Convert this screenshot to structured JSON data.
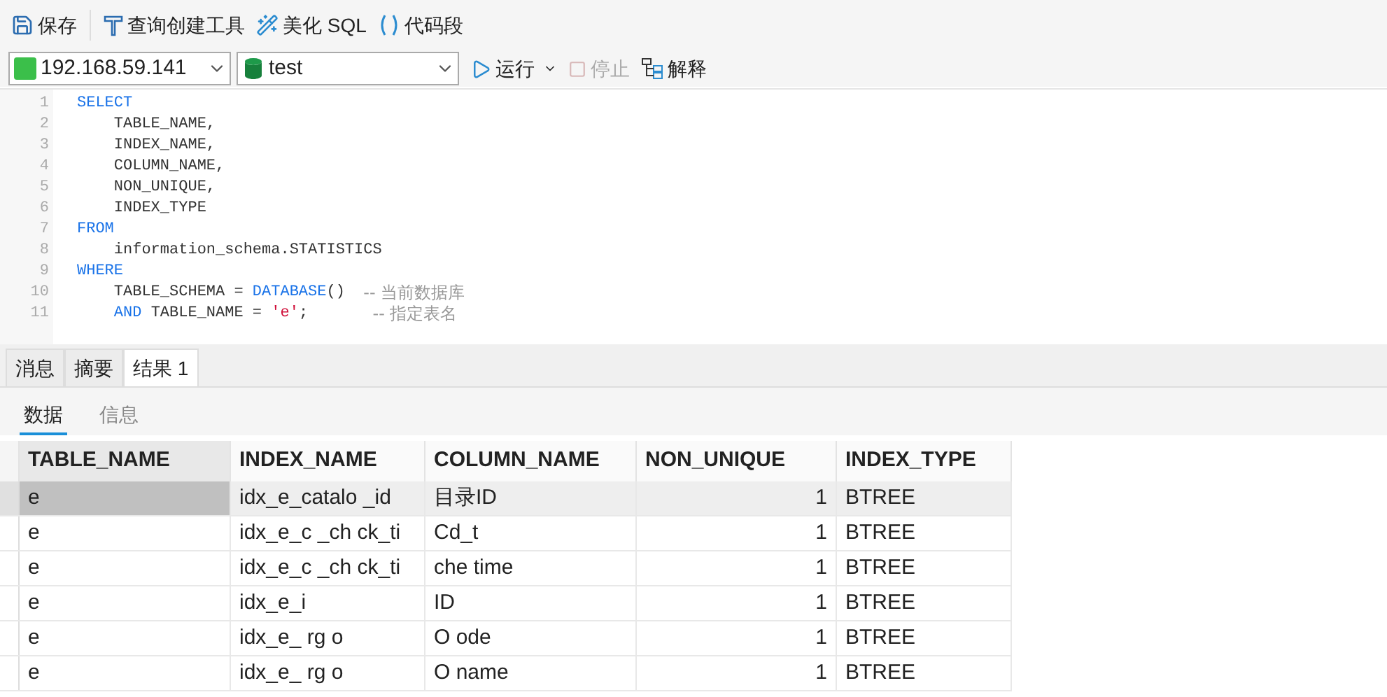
{
  "toolbar": [
    {
      "label": "保存"
    },
    {
      "label": "查询创建工具"
    },
    {
      "label": "美化 SQL"
    },
    {
      "label": "代码段"
    }
  ],
  "connection": {
    "value": "192.168.59.141"
  },
  "database": {
    "value": "test"
  },
  "actions": [
    {
      "label": "运行",
      "kind": "run",
      "disabled": false
    },
    {
      "label": "停止",
      "kind": "stop",
      "disabled": true
    },
    {
      "label": "解释",
      "kind": "explain",
      "disabled": false
    }
  ],
  "editor": {
    "lines": [
      {
        "number": "1",
        "tokens": [
          {
            "text": "SELECT",
            "kind": "keyword"
          }
        ]
      },
      {
        "number": "2",
        "tokens": [
          {
            "text": "    TABLE_NAME,",
            "kind": "plain"
          }
        ]
      },
      {
        "number": "3",
        "tokens": [
          {
            "text": "    INDEX_NAME,",
            "kind": "plain"
          }
        ]
      },
      {
        "number": "4",
        "tokens": [
          {
            "text": "    COLUMN_NAME,",
            "kind": "plain"
          }
        ]
      },
      {
        "number": "5",
        "tokens": [
          {
            "text": "    NON_UNIQUE,",
            "kind": "plain"
          }
        ]
      },
      {
        "number": "6",
        "tokens": [
          {
            "text": "    INDEX_TYPE",
            "kind": "plain"
          }
        ]
      },
      {
        "number": "7",
        "tokens": [
          {
            "text": "FROM",
            "kind": "keyword"
          }
        ]
      },
      {
        "number": "8",
        "tokens": [
          {
            "text": "    information_schema.STATISTICS",
            "kind": "plain"
          }
        ]
      },
      {
        "number": "9",
        "tokens": [
          {
            "text": "WHERE",
            "kind": "keyword"
          }
        ]
      },
      {
        "number": "10",
        "tokens": [
          {
            "text": "    TABLE_SCHEMA = ",
            "kind": "plain"
          },
          {
            "text": "DATABASE",
            "kind": "keyword"
          },
          {
            "text": "()  ",
            "kind": "plain"
          },
          {
            "text": "-- 当前数据库",
            "kind": "comment"
          }
        ]
      },
      {
        "number": "11",
        "tokens": [
          {
            "text": "    AND",
            "kind": "keyword"
          },
          {
            "text": " TABLE_NAME = ",
            "kind": "plain"
          },
          {
            "text": "'e'",
            "kind": "string"
          },
          {
            "text": ";       ",
            "kind": "plain"
          },
          {
            "text": "-- 指定表名",
            "kind": "comment"
          }
        ]
      }
    ]
  },
  "result_tabs": [
    {
      "label": "消息",
      "selected": false
    },
    {
      "label": "摘要",
      "selected": false
    },
    {
      "label": "结果 1",
      "selected": true
    }
  ],
  "sub_tabs": [
    {
      "label": "数据",
      "selected": true
    },
    {
      "label": "信息",
      "selected": false
    }
  ],
  "table": {
    "columns": [
      {
        "label": "TABLE_NAME",
        "kind": "text"
      },
      {
        "label": "INDEX_NAME",
        "kind": "text"
      },
      {
        "label": "COLUMN_NAME",
        "kind": "text"
      },
      {
        "label": "NON_UNIQUE",
        "kind": "number"
      },
      {
        "label": "INDEX_TYPE",
        "kind": "text"
      }
    ],
    "rows": [
      {
        "selected": true,
        "cells": [
          "e",
          "idx_e_catalo _id",
          "目录ID",
          "1",
          "BTREE"
        ]
      },
      {
        "selected": false,
        "cells": [
          "e",
          "idx_e_c _ch ck_ti",
          "Cd_t",
          "1",
          "BTREE"
        ]
      },
      {
        "selected": false,
        "cells": [
          "e",
          "idx_e_c _ch ck_ti",
          "che time",
          "1",
          "BTREE"
        ]
      },
      {
        "selected": false,
        "cells": [
          "e",
          "idx_e_i",
          "ID",
          "1",
          "BTREE"
        ]
      },
      {
        "selected": false,
        "cells": [
          "e",
          "idx_e_ rg o",
          "O ode",
          "1",
          "BTREE"
        ]
      },
      {
        "selected": false,
        "cells": [
          "e",
          "idx_e_ rg o",
          "O name",
          "1",
          "BTREE"
        ]
      }
    ]
  }
}
